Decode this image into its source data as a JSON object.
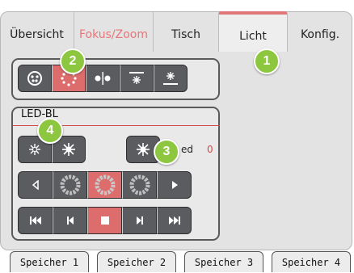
{
  "tabs": [
    {
      "label": "Übersicht"
    },
    {
      "label": "Fokus/Zoom"
    },
    {
      "label": "Tisch"
    },
    {
      "label": "Licht"
    },
    {
      "label": "Konfig."
    }
  ],
  "led": {
    "title": "LED-BL",
    "status_label": "ed",
    "status_value": "0"
  },
  "badges": [
    "1",
    "2",
    "3",
    "4"
  ],
  "memory_tabs": [
    {
      "label": "Speicher 1"
    },
    {
      "label": "Speicher 2"
    },
    {
      "label": "Speicher 3"
    },
    {
      "label": "Speicher 4"
    }
  ],
  "colors": {
    "accent_red": "#dd6d6d",
    "badge_green": "#8dc63f",
    "button_dark": "#5a5c60"
  }
}
